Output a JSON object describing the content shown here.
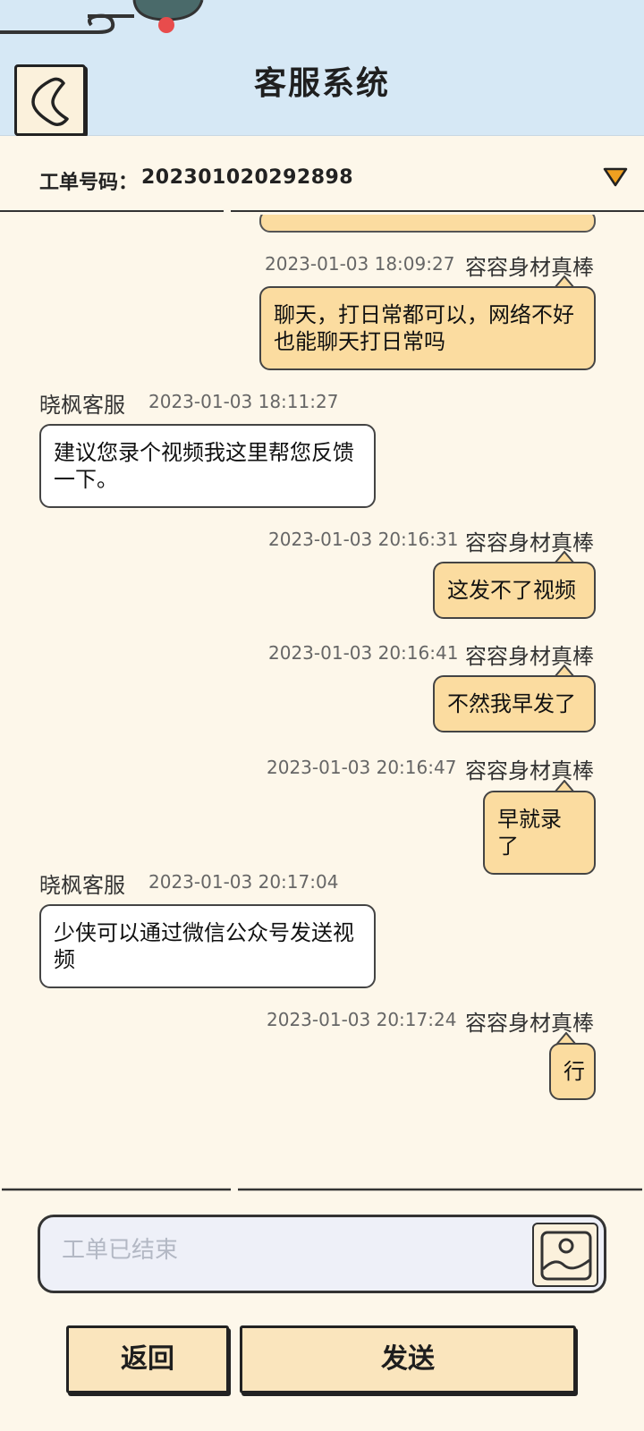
{
  "header": {
    "title": "客服系统"
  },
  "ticket": {
    "label": "工单号码：",
    "number": "202301020292898"
  },
  "messages": [
    {
      "sender": "容容身材真棒",
      "time": "2023-01-03 18:09:27",
      "text": "聊天，打日常都可以，网络不好也能聊天打日常吗"
    },
    {
      "sender": "晓枫客服",
      "time": "2023-01-03 18:11:27",
      "text": "建议您录个视频我这里帮您反馈一下。"
    },
    {
      "sender": "容容身材真棒",
      "time": "2023-01-03 20:16:31",
      "text": "这发不了视频"
    },
    {
      "sender": "容容身材真棒",
      "time": "2023-01-03 20:16:41",
      "text": "不然我早发了"
    },
    {
      "sender": "容容身材真棒",
      "time": "2023-01-03 20:16:47",
      "text": "早就录了"
    },
    {
      "sender": "晓枫客服",
      "time": "2023-01-03 20:17:04",
      "text": "少侠可以通过微信公众号发送视频"
    },
    {
      "sender": "容容身材真棒",
      "time": "2023-01-03 20:17:24",
      "text": "行"
    }
  ],
  "input": {
    "placeholder": "工单已结束"
  },
  "buttons": {
    "back": "返回",
    "send": "发送"
  },
  "colors": {
    "header_bg": "#d6e8f5",
    "page_bg": "#fdf7ea",
    "my_bubble": "#fbdca0",
    "agent_bubble": "#ffffff",
    "button_bg": "#fae5bd",
    "toggle_arrow": "#f0a020"
  }
}
